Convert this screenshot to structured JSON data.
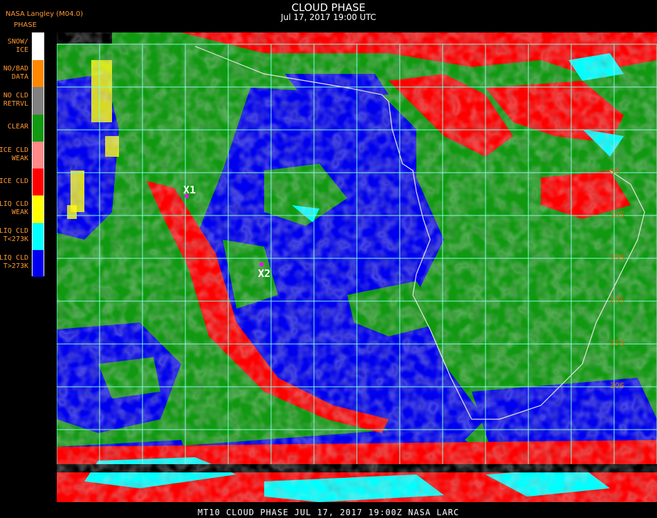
{
  "header": {
    "source": "NASA Langley (M04.0)",
    "legend_title": "PHASE",
    "title": "CLOUD PHASE",
    "datetime": "Jul 17, 2017 19:00 UTC"
  },
  "legend": [
    {
      "label_lines": [
        "SNOW/",
        "ICE"
      ],
      "color": "#ffffff"
    },
    {
      "label_lines": [
        "NO/BAD",
        "DATA"
      ],
      "color": "#ff8800"
    },
    {
      "label_lines": [
        "NO CLD",
        "RETRVL"
      ],
      "color": "#808080"
    },
    {
      "label_lines": [
        "CLEAR"
      ],
      "color": "#119911"
    },
    {
      "label_lines": [
        "ICE CLD",
        "WEAK"
      ],
      "color": "#ff8888"
    },
    {
      "label_lines": [
        "ICE CLD"
      ],
      "color": "#ff0000"
    },
    {
      "label_lines": [
        "LIQ CLD",
        "WEAK"
      ],
      "color": "#ffff00"
    },
    {
      "label_lines": [
        "LIQ CLD",
        "T<273K"
      ],
      "color": "#00ffff"
    },
    {
      "label_lines": [
        "LIQ CLD",
        "T>273K"
      ],
      "color": "#0000ee"
    }
  ],
  "markers": [
    {
      "label": "X1"
    },
    {
      "label": "X2"
    }
  ],
  "lat_labels": [
    "5S",
    "10S",
    "15S",
    "20S",
    "25S",
    "30S"
  ],
  "footer": "MT10   CLOUD PHASE   JUL 17, 2017 19:00Z   NASA LARC"
}
